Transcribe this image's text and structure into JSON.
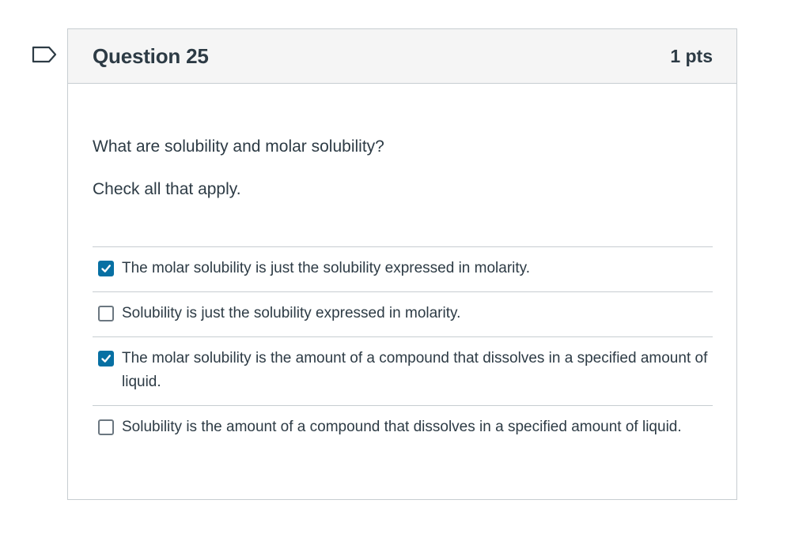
{
  "question": {
    "title": "Question 25",
    "points": "1 pts",
    "text": "What are solubility and molar solubility?",
    "instruction": "Check all that apply."
  },
  "flag": {
    "icon": "bookmark-flag-icon",
    "color": "#2d3b45"
  },
  "answers": [
    {
      "label": "The molar solubility is just the solubility expressed in molarity.",
      "checked": true
    },
    {
      "label": "Solubility is just the solubility expressed in molarity.",
      "checked": false
    },
    {
      "label": "The molar solubility is the amount of a compound that dissolves in a specified amount of liquid.",
      "checked": true
    },
    {
      "label": "Solubility is the amount of a compound that dissolves in a specified amount of liquid.",
      "checked": false
    }
  ],
  "colors": {
    "checkbox_checked": "#0770a3",
    "header_bg": "#f5f5f5",
    "border": "#c7cdd1",
    "text": "#2d3b45"
  }
}
